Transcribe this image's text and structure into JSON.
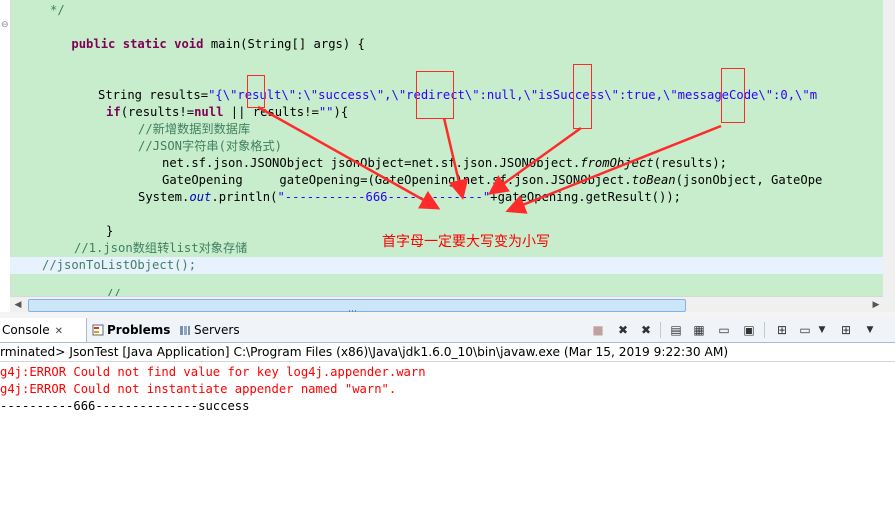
{
  "editor": {
    "comment_end": "*/",
    "main_signature": {
      "kw1": "public",
      "kw2": "static",
      "kw3": "void",
      "rest": "main(String[] args) {"
    },
    "results_line": {
      "prefix": "String results=",
      "literal": "\"{\\\"result\\\":\\\"success\\\",\\\"redirect\\\":null,\\\"isSuccess\\\":true,\\\"messageCode\\\":0,\\\"m"
    },
    "if_line": {
      "kw_if": "if",
      "mid": "(results!=",
      "kw_null": "null",
      "mid2": " || results!=",
      "str": "\"\"",
      "end": "){"
    },
    "comment_add": "//新增数据到数据库",
    "comment_json": "//JSON字符串(对象格式)",
    "json_obj_line": {
      "pre": "net.sf.json.JSONObject jsonObject=net.sf.json.JSONObject.",
      "method": "fromObject",
      "post": "(results);"
    },
    "gate_line": {
      "pre": "GateOpening     gateOpening=(GateOpening)net.sf.json.JSONObject.",
      "method": "toBean",
      "post": "(jsonObject, GateOpe"
    },
    "println_line": {
      "pre": "System.",
      "field": "out",
      "mid": ".println(",
      "str": "\"-----------666-------------\"",
      "post": "+gateOpening.getResult());"
    },
    "close_brace": "}",
    "comment_list": "//1.json数组转list对象存储",
    "comment_call": "//jsonToListObject();",
    "annotation": "首字母一定要大写变为小写",
    "colors": {
      "annotation": "#ff0000",
      "background": "#c7edcc"
    }
  },
  "scrollbar": {
    "grip_icon": "grip-lines"
  },
  "tabs": [
    {
      "label": "Console",
      "icon": "console-icon",
      "close": "✕"
    },
    {
      "label": "Problems",
      "icon": "problems-icon"
    },
    {
      "label": "Servers",
      "icon": "servers-icon"
    }
  ],
  "toolbar": [
    "terminate-icon",
    "remove-launch-icon",
    "remove-all-icon",
    "scroll-lock-icon",
    "word-wrap-icon",
    "show-stdout-icon",
    "show-stderr-icon",
    "pin-console-icon",
    "display-console-icon",
    "open-console-icon",
    "view-menu-icon"
  ],
  "status": {
    "text": "rminated> JsonTest [Java Application] C:\\Program Files (x86)\\Java\\jdk1.6.0_10\\bin\\javaw.exe (Mar 15, 2019 9:22:30 AM)"
  },
  "console": {
    "lines": [
      {
        "text": "g4j:ERROR Could not find value for key log4j.appender.warn",
        "kind": "error"
      },
      {
        "text": "g4j:ERROR Could not instantiate appender named \"warn\".",
        "kind": "error"
      },
      {
        "text": "----------666--------------success",
        "kind": "output"
      }
    ]
  }
}
